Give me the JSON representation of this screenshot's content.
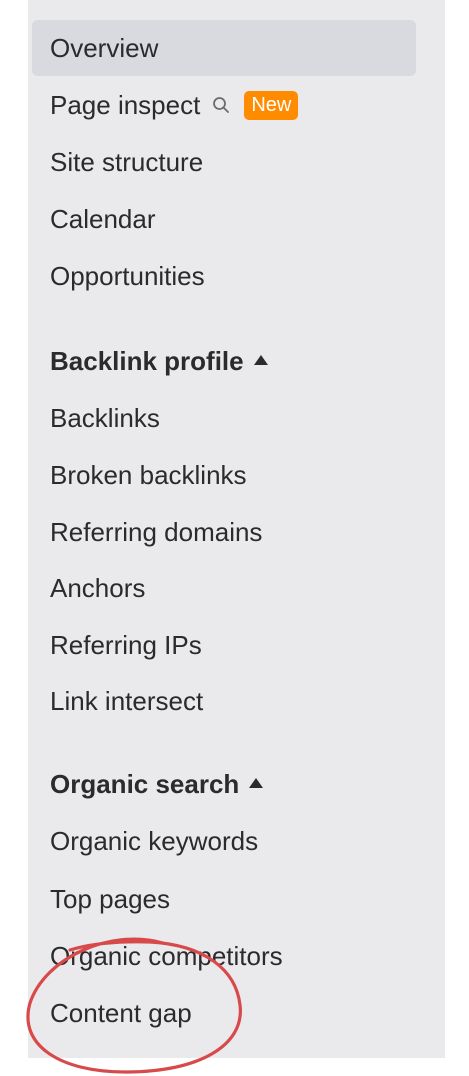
{
  "nav": {
    "items": [
      {
        "label": "Overview"
      },
      {
        "label": "Page inspect",
        "badge": "New",
        "icon": "search-icon"
      },
      {
        "label": "Site structure"
      },
      {
        "label": "Calendar"
      },
      {
        "label": "Opportunities"
      }
    ]
  },
  "backlink_profile": {
    "title": "Backlink profile",
    "caret_icon": "caret-up-icon",
    "items": [
      {
        "label": "Backlinks"
      },
      {
        "label": "Broken backlinks"
      },
      {
        "label": "Referring domains"
      },
      {
        "label": "Anchors"
      },
      {
        "label": "Referring IPs"
      },
      {
        "label": "Link intersect"
      }
    ]
  },
  "organic_search": {
    "title": "Organic search",
    "caret_icon": "caret-up-icon",
    "items": [
      {
        "label": "Organic keywords"
      },
      {
        "label": "Top pages"
      },
      {
        "label": "Organic competitors"
      },
      {
        "label": "Content gap"
      }
    ]
  },
  "colors": {
    "sidebar_bg": "#eaeaed",
    "active_bg": "#d9dadf",
    "badge_bg": "#ff8b00",
    "annotation": "#d84a4a"
  }
}
